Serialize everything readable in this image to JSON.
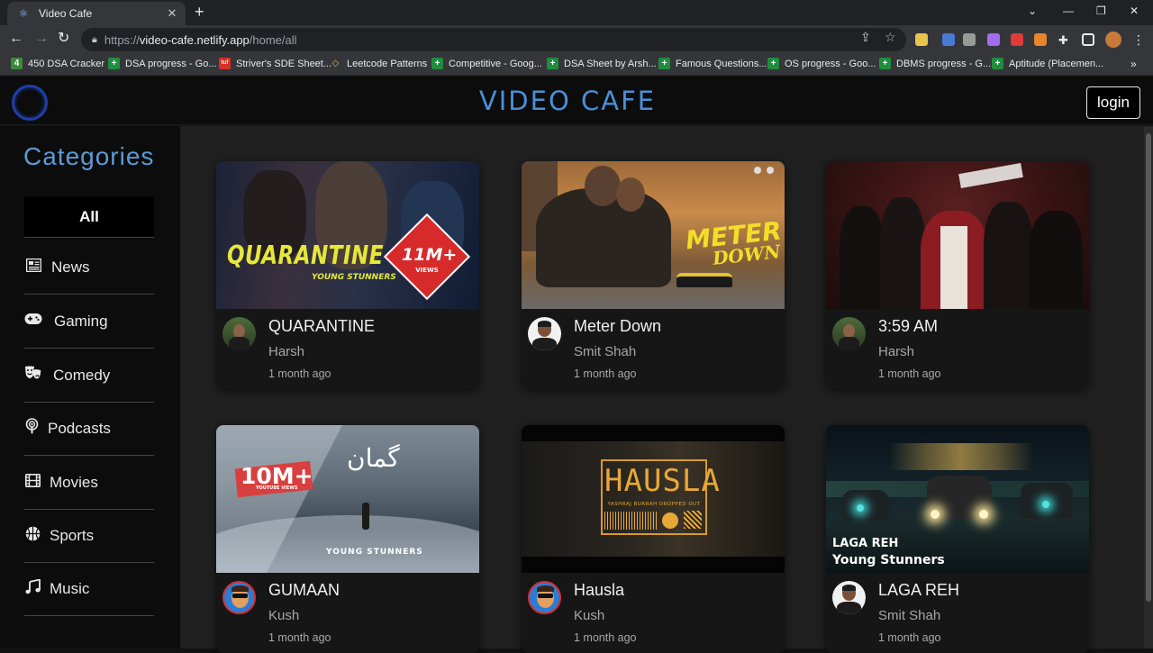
{
  "browser": {
    "tab_title": "Video Cafe",
    "url_scheme": "https://",
    "url_host": "video-cafe.netlify.app",
    "url_path": "/home/all"
  },
  "bookmarks": [
    {
      "label": "450 DSA Cracker",
      "icon": "4",
      "color": "#3c8a3c"
    },
    {
      "label": "DSA progress - Go...",
      "icon": "+",
      "color": "#1e8e3e"
    },
    {
      "label": "Striver's SDE Sheet...",
      "icon": "tuf",
      "color": "#d93025"
    },
    {
      "label": "Leetcode Patterns",
      "icon": "◇",
      "color": "#f2b94b"
    },
    {
      "label": "Competitive - Goog...",
      "icon": "+",
      "color": "#1e8e3e"
    },
    {
      "label": "DSA Sheet by Arsh...",
      "icon": "+",
      "color": "#1e8e3e"
    },
    {
      "label": "Famous Questions...",
      "icon": "+",
      "color": "#1e8e3e"
    },
    {
      "label": "OS progress - Goo...",
      "icon": "+",
      "color": "#1e8e3e"
    },
    {
      "label": "DBMS progress - G...",
      "icon": "+",
      "color": "#1e8e3e"
    },
    {
      "label": "Aptitude (Placemen...",
      "icon": "+",
      "color": "#1e8e3e"
    }
  ],
  "header": {
    "brand": "VIDEO CAFE",
    "login_label": "login"
  },
  "sidebar": {
    "title": "Categories",
    "all_label": "All",
    "items": [
      {
        "label": "News",
        "icon": "newspaper-icon"
      },
      {
        "label": "Gaming",
        "icon": "gamepad-icon"
      },
      {
        "label": "Comedy",
        "icon": "theater-masks-icon"
      },
      {
        "label": "Podcasts",
        "icon": "podcast-icon"
      },
      {
        "label": "Movies",
        "icon": "film-icon"
      },
      {
        "label": "Sports",
        "icon": "basketball-icon"
      },
      {
        "label": "Music",
        "icon": "music-note-icon"
      }
    ]
  },
  "videos": [
    {
      "title": "QUARANTINE",
      "channel": "Harsh",
      "time": "1 month ago",
      "thumb_text": "QUARANTINE",
      "thumb_sub": "YOUNG STUNNERS",
      "badge": "11M+",
      "badge_sub": "VIEWS"
    },
    {
      "title": "Meter Down",
      "channel": "Smit Shah",
      "time": "1 month ago",
      "thumb_text": "METER",
      "thumb_sub": "DOWN"
    },
    {
      "title": "3:59 AM",
      "channel": "Harsh",
      "time": "1 month ago"
    },
    {
      "title": "GUMAAN",
      "channel": "Kush",
      "time": "1 month ago",
      "thumb_text": "گمان",
      "thumb_sub": "YOUNG STUNNERS",
      "badge": "10M+",
      "badge_sub": "YOUTUBE VIEWS"
    },
    {
      "title": "Hausla",
      "channel": "Kush",
      "time": "1 month ago",
      "thumb_text": "HAUSLA",
      "thumb_sub": "YASHRAJ  BURRAH  DROPPED OUT"
    },
    {
      "title": "LAGA REH",
      "channel": "Smit Shah",
      "time": "1 month ago",
      "thumb_text": "LAGA REH",
      "thumb_sub": "Young Stunners"
    }
  ],
  "colors": {
    "brand": "#4a8fd8",
    "sidebar_title": "#5c9ad6",
    "card_bg": "#161616",
    "content_bg": "#202020"
  }
}
